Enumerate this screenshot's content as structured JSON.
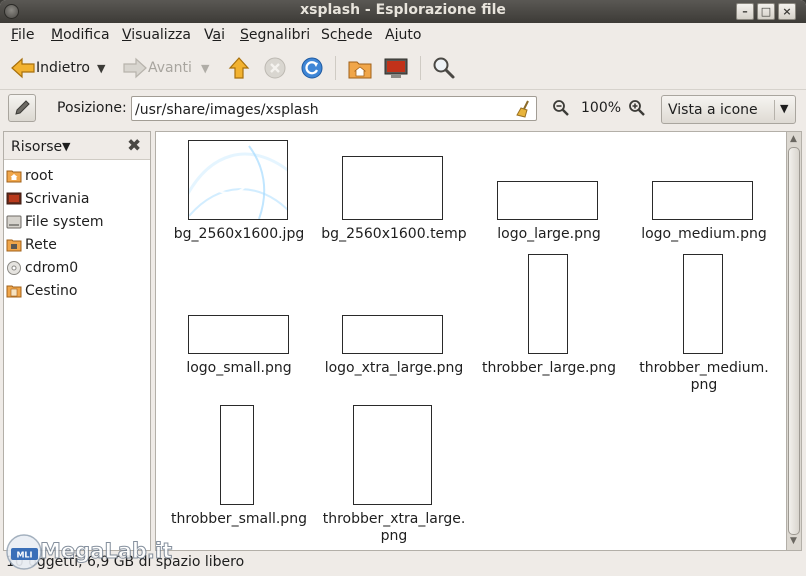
{
  "window": {
    "title": "xsplash - Esplorazione file"
  },
  "menubar": {
    "items": [
      {
        "label": "File",
        "mnemonic": "F",
        "rest": "ile"
      },
      {
        "label": "Modifica",
        "mnemonic": "M",
        "rest": "odifica"
      },
      {
        "label": "Visualizza",
        "mnemonic": "V",
        "rest": "isualizza"
      },
      {
        "label": "Vai",
        "pre": "V",
        "mnemonic": "a",
        "rest": "i"
      },
      {
        "label": "Segnalibri",
        "mnemonic": "S",
        "rest": "egnalibri"
      },
      {
        "label": "Schede",
        "pre": "Sc",
        "mnemonic": "h",
        "rest": "ede"
      },
      {
        "label": "Aiuto",
        "pre": "A",
        "mnemonic": "i",
        "rest": "uto"
      }
    ]
  },
  "toolbar": {
    "back_label": "Indietro",
    "forward_label": "Avanti"
  },
  "location": {
    "label": "Posizione:",
    "path": "/usr/share/images/xsplash",
    "zoom": "100%",
    "view_mode": "Vista a icone"
  },
  "sidebar": {
    "title": "Risorse",
    "items": [
      {
        "label": "root",
        "icon": "home-folder-icon"
      },
      {
        "label": "Scrivania",
        "icon": "desktop-icon"
      },
      {
        "label": "File system",
        "icon": "drive-icon"
      },
      {
        "label": "Rete",
        "icon": "network-icon"
      },
      {
        "label": "cdrom0",
        "icon": "cdrom-icon"
      },
      {
        "label": "Cestino",
        "icon": "trash-icon"
      }
    ]
  },
  "files": [
    {
      "name": "bg_2560x1600.jpg",
      "thumb": "blue"
    },
    {
      "name": "bg_2560x1600.temp",
      "thumb": "brown"
    },
    {
      "name": "logo_large.png",
      "thumb": "blank"
    },
    {
      "name": "logo_medium.png",
      "thumb": "blank"
    },
    {
      "name": "logo_small.png",
      "thumb": "blank"
    },
    {
      "name": "logo_xtra_large.png",
      "thumb": "blank"
    },
    {
      "name": "throbber_large.png",
      "thumb": "blank"
    },
    {
      "name": "throbber_medium.",
      "name2": "png",
      "thumb": "blank"
    },
    {
      "name": "throbber_small.png",
      "thumb": "blank"
    },
    {
      "name": "throbber_xtra_large.",
      "name2": "png",
      "thumb": "blank"
    }
  ],
  "statusbar": {
    "text": "10 oggetti, 6,9 GB di spazio libero"
  },
  "watermark": {
    "text": "MegaLab.it",
    "badge": "MLI"
  },
  "colors": {
    "title_bg": "#3d3b37",
    "window_bg": "#efebe7",
    "accent_orange": "#f0a020"
  }
}
